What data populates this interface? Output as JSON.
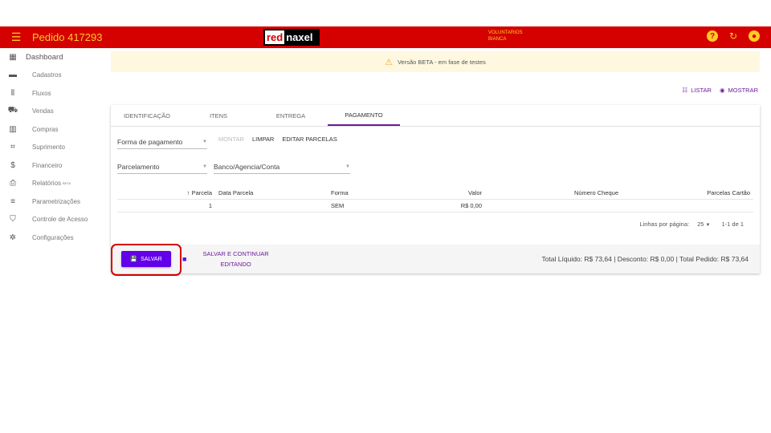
{
  "appbar": {
    "title": "Pedido 417293",
    "logo_red": "red",
    "logo_white": "naxel",
    "user_line1": "VOLUNTARIOS",
    "user_line2": "BIANCA",
    "help_icon": "help-circle-icon",
    "refresh_icon": "refresh-icon",
    "account_icon": "account-circle-icon",
    "colors": {
      "bar": "#d50000",
      "text": "#ffca28"
    }
  },
  "sidebar": {
    "items": [
      {
        "label": "Dashboard",
        "icon": "dashboard-icon",
        "glyph": "▦"
      },
      {
        "label": "Cadastros",
        "icon": "folder-icon",
        "glyph": "▬"
      },
      {
        "label": "Fluxos",
        "icon": "columns-icon",
        "glyph": "⦀"
      },
      {
        "label": "Vendas",
        "icon": "cart-icon",
        "glyph": "⛟"
      },
      {
        "label": "Compras",
        "icon": "building-icon",
        "glyph": "▥"
      },
      {
        "label": "Suprimento",
        "icon": "crop-icon",
        "glyph": "⌗"
      },
      {
        "label": "Financeiro",
        "icon": "dollar-icon",
        "glyph": "$"
      },
      {
        "label": "Relatórios",
        "badge": "BETA",
        "icon": "printer-icon",
        "glyph": "⎙"
      },
      {
        "label": "Parametrizações",
        "icon": "tune-icon",
        "glyph": "≡"
      },
      {
        "label": "Controle de Acesso",
        "icon": "shield-icon",
        "glyph": "⛉"
      },
      {
        "label": "Configurações",
        "icon": "gear-icon",
        "glyph": "✲"
      }
    ]
  },
  "banner": {
    "text": "Versão BETA - em fase de testes"
  },
  "toolbar": {
    "listar": "LISTAR",
    "mostrar": "MOSTRAR"
  },
  "tabs": [
    "IDENTIFICAÇÃO",
    "ITENS",
    "ENTREGA",
    "PAGAMENTO"
  ],
  "active_tab": "PAGAMENTO",
  "form": {
    "forma_pagamento": "Forma de pagamento",
    "montar": "MONTAR",
    "limpar": "LIMPAR",
    "editar_parcelas": "EDITAR PARCELAS",
    "parcelamento": "Parcelamento",
    "banco": "Banco/Agencia/Conta"
  },
  "table": {
    "headers": [
      "Parcela",
      "Data Parcela",
      "Forma",
      "Valor",
      "Número Cheque",
      "Parcelas Cartão"
    ],
    "rows": [
      [
        "1",
        "",
        "SEM",
        "R$ 0,00",
        "",
        ""
      ]
    ]
  },
  "pager": {
    "label": "Linhas por página:",
    "per_page": "25",
    "range": "1-1 de 1"
  },
  "footer": {
    "save": "SALVAR",
    "save_continue_1": "SALVAR E CONTINUAR",
    "save_continue_2": "EDITANDO",
    "totals": "Total Líquido: R$ 73,64 | Desconto: R$ 0,00 | Total Pedido: R$ 73,64"
  }
}
